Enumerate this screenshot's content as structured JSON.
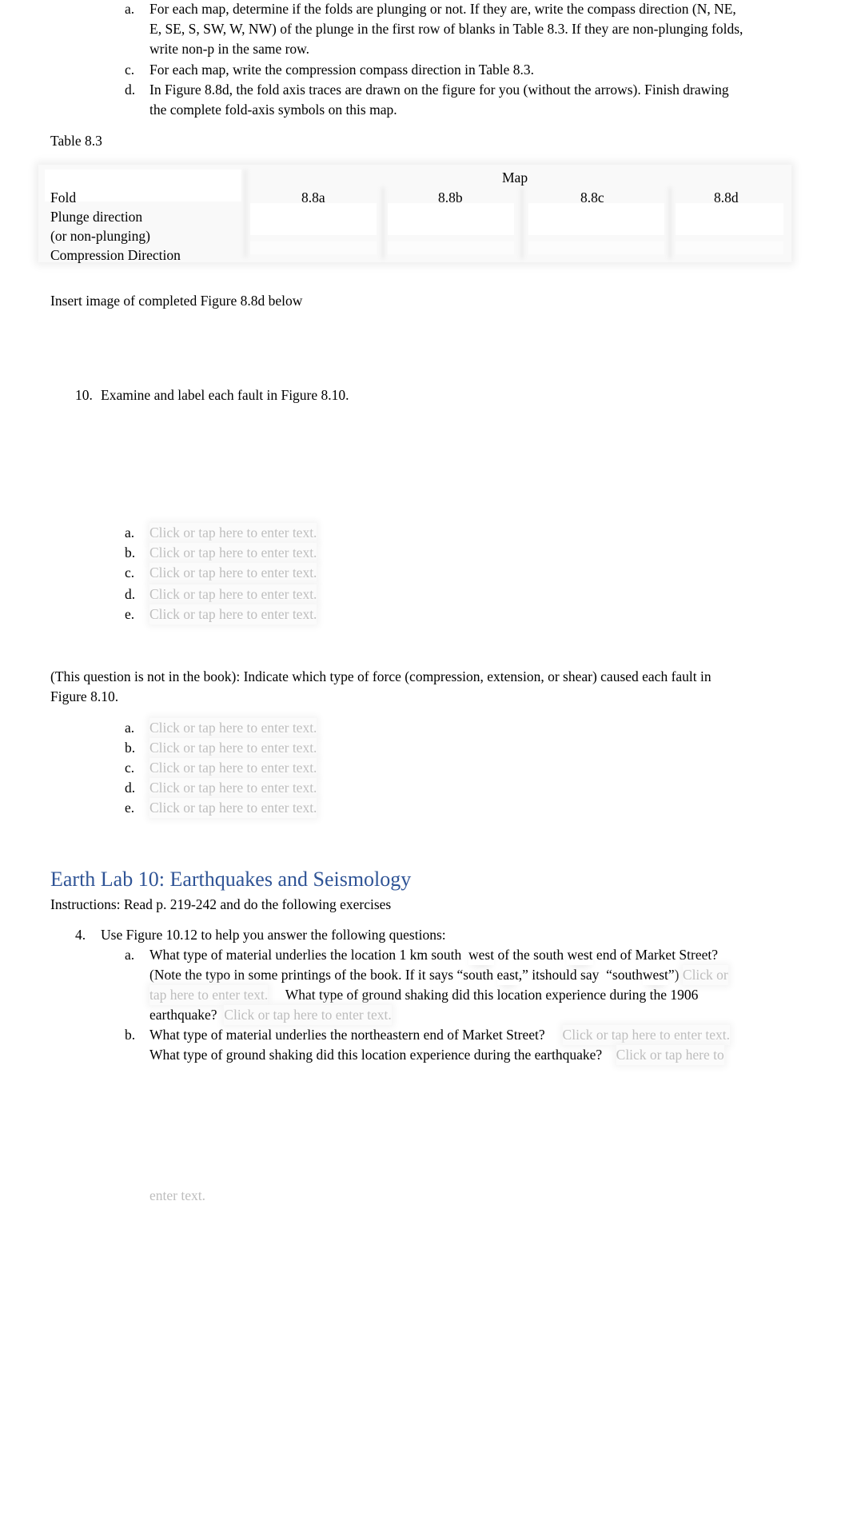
{
  "top_list": [
    {
      "label": "a.",
      "lines": [
        "For each map, determine if the folds are plunging or not. If they are, write the compass direction (N, NE,",
        "E, SE, S, SW, W, NW) of the plunge in the first row of blanks in Table 8.3. If they are non-plunging folds,",
        "write non-p in the same row."
      ]
    },
    {
      "label": "c.",
      "lines": [
        "For each map, write the compression compass direction in Table 8.3."
      ]
    },
    {
      "label": "d.",
      "lines": [
        "In Figure 8.8d, the fold axis traces are drawn on the figure for you (without the arrows). Finish drawing",
        "the complete fold-axis symbols on this map."
      ]
    }
  ],
  "table": {
    "caption": "Table 8.3",
    "group_header": "Map",
    "row_labels": [
      "Fold",
      "Plunge direction",
      "(or non-plunging)",
      "Compression Direction"
    ],
    "columns": [
      "8.8a",
      "8.8b",
      "8.8c",
      "8.8d"
    ],
    "plunge_values": [
      "",
      "",
      "",
      ""
    ],
    "compression_values": [
      "",
      "",
      "",
      ""
    ]
  },
  "insert_note": "Insert image of completed Figure 8.8d below",
  "q10": {
    "number": "10.",
    "text": "Examine and label each fault in Figure 8.10.",
    "answers": [
      {
        "label": "a.",
        "placeholder": "Click or tap here to enter text."
      },
      {
        "label": "b.",
        "placeholder": "Click or tap here to enter text."
      },
      {
        "label": "c.",
        "placeholder": "Click or tap here to enter text."
      },
      {
        "label": "d.",
        "placeholder": "Click or tap here to enter text."
      },
      {
        "label": "e.",
        "placeholder": "Click or tap here to enter text."
      }
    ]
  },
  "force_question": {
    "lines": [
      "(This question is not in the book): Indicate which type of force (compression, extension, or shear) caused each fault in",
      "Figure 8.10."
    ],
    "answers": [
      {
        "label": "a.",
        "placeholder": "Click or tap here to enter text."
      },
      {
        "label": "b.",
        "placeholder": "Click or tap here to enter text."
      },
      {
        "label": "c.",
        "placeholder": "Click or tap here to enter text."
      },
      {
        "label": "d.",
        "placeholder": "Click or tap here to enter text."
      },
      {
        "label": "e.",
        "placeholder": "Click or tap here to enter text."
      }
    ]
  },
  "lab10": {
    "heading": "Earth Lab 10: Earthquakes and Seismology",
    "instructions_label": "Instructions",
    "instructions_text": ": Read p. 219-242 and do the following exercises",
    "q4": {
      "number": "4.",
      "text": "Use Figure 10.12 to help you answer the following questions:",
      "a": {
        "label": "a.",
        "line1_pre": "What type of material underlies the location 1 km south",
        "line1_w1": "west",
        "line1_mid": "of the south",
        "line1_w2": "west",
        "line1_post": "end of Market Street?",
        "line2_text": "(Note the typo in some printings of the book. If it says “south",
        "line2_east": "east",
        "line2_mid": ",” it",
        "line2_should": "should say",
        "line2_q": "“south",
        "line2_west": "west",
        "line2_end": "”)",
        "placeholder1_part1": "Click or",
        "placeholder1_part2": "tap here to enter text.",
        "question2": "What type of ground shaking did this location experience during the 1906",
        "question2_end": "earthquake?",
        "placeholder2": "Click or tap here to enter text."
      },
      "b": {
        "label": "b.",
        "question1": "What type of material underlies the northeastern end of Market Street?",
        "placeholder1": "Click or tap here to enter text.",
        "question2": "What type of ground shaking did this location experience during the earthquake?",
        "placeholder2_part1": "Click or tap here to",
        "placeholder2_part2": "enter text."
      }
    }
  }
}
